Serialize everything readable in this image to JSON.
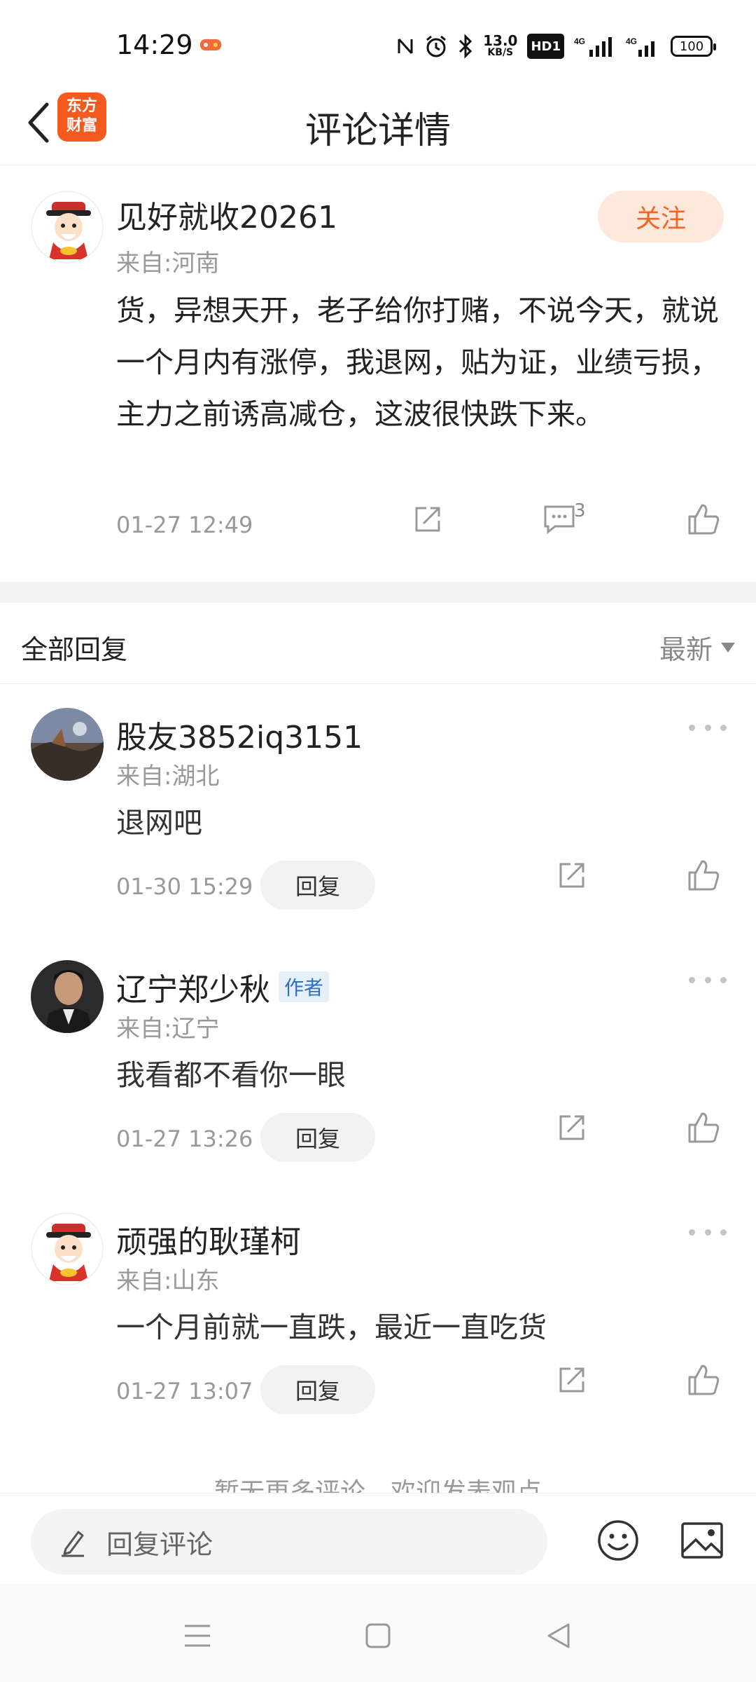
{
  "status_bar": {
    "time": "14:29",
    "net_speed_value": "13.0",
    "net_speed_unit": "KB/S",
    "hd_label": "HD1",
    "battery": "100"
  },
  "header": {
    "logo_line1": "东方",
    "logo_line2": "财富",
    "title": "评论详情"
  },
  "post": {
    "username": "见好就收20261",
    "location": "来自:河南",
    "follow_label": "关注",
    "text": "货，异想天开，老子给你打赌，不说今天，就说一个月内有涨停，我退网，贴为证，业绩亏损，主力之前诱高减仓，这波很快跌下来。",
    "time": "01-27 12:49",
    "comment_count": "3"
  },
  "replies_header": {
    "title": "全部回复",
    "sort_label": "最新"
  },
  "replies": [
    {
      "username": "股友3852iq3151",
      "badge": "",
      "location": "来自:湖北",
      "text": "退网吧",
      "time": "01-30 15:29",
      "reply_label": "回复"
    },
    {
      "username": "辽宁郑少秋",
      "badge": "作者",
      "location": "来自:辽宁",
      "text": "我看都不看你一眼",
      "time": "01-27 13:26",
      "reply_label": "回复"
    },
    {
      "username": "顽强的耿瑾柯",
      "badge": "",
      "location": "来自:山东",
      "text": "一个月前就一直跌，最近一直吃货",
      "time": "01-27 13:07",
      "reply_label": "回复"
    }
  ],
  "footer_note": "暂无更多评论，欢迎发表观点",
  "bottom_bar": {
    "input_placeholder": "回复评论"
  },
  "colors": {
    "accent": "#f26522",
    "follow_bg": "#fde8dc",
    "author_badge": "#2b6fc6",
    "muted_text": "#999999"
  },
  "icons": [
    "back-icon",
    "share-icon",
    "comment-icon",
    "like-icon",
    "more-icon",
    "edit-icon",
    "emoji-icon",
    "image-icon",
    "menu-icon",
    "home-icon",
    "back-triangle-icon"
  ]
}
